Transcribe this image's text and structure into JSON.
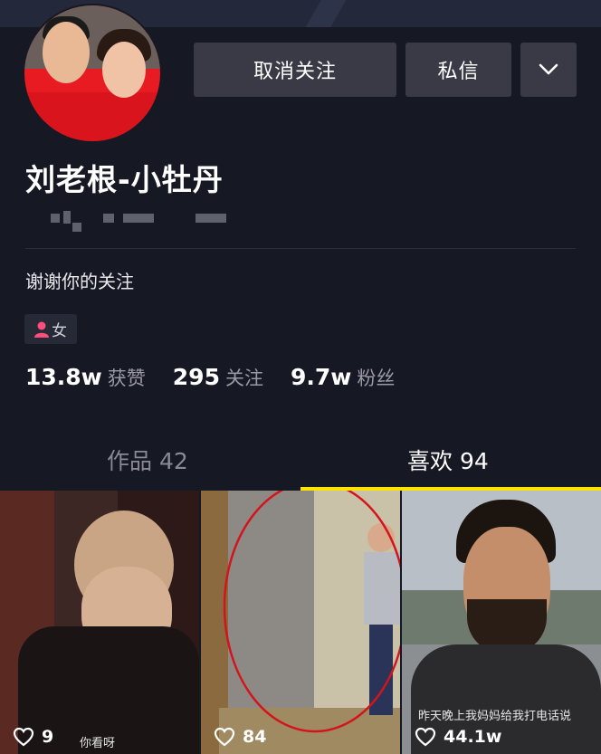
{
  "profile": {
    "name": "刘老根-小牡丹",
    "signature": "谢谢你的关注",
    "gender": "女",
    "stats": [
      {
        "value": "13.8w",
        "label": "获赞"
      },
      {
        "value": "295",
        "label": "关注"
      },
      {
        "value": "9.7w",
        "label": "粉丝"
      }
    ]
  },
  "actions": {
    "unfollow_label": "取消关注",
    "message_label": "私信",
    "more_icon": "chevron-down-icon"
  },
  "tabs": [
    {
      "label": "作品 42",
      "active": false
    },
    {
      "label": "喜欢 94",
      "active": true
    }
  ],
  "videos": [
    {
      "likes": "9",
      "caption": "你看呀"
    },
    {
      "likes": "84",
      "caption": ""
    },
    {
      "likes": "44.1w",
      "caption": "昨天晚上我妈妈给我打电话说"
    }
  ],
  "colors": {
    "background": "#161823",
    "button": "#3a3a46",
    "accent_underline": "#ffe300",
    "gender_icon": "#ff4d7d",
    "annotation_circle": "#d4141c"
  }
}
